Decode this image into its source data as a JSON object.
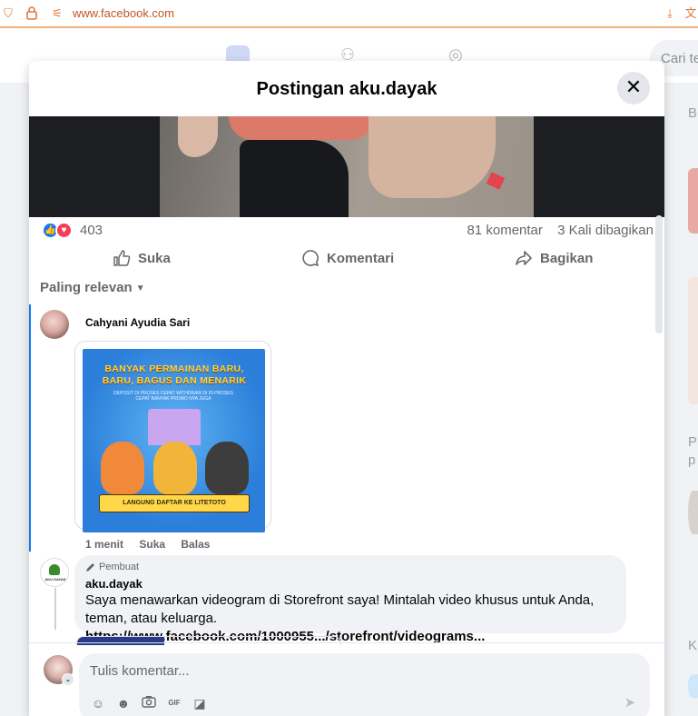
{
  "browser": {
    "url": "www.facebook.com",
    "icons": [
      "shield-icon",
      "lock-icon",
      "site-settings-icon",
      "download-icon",
      "translate-icon"
    ]
  },
  "fb_header": {
    "search_placeholder": "Cari te"
  },
  "right_rail": {
    "text_1": "B",
    "text_2": "P",
    "text_3": "p",
    "text_4": "K"
  },
  "modal": {
    "title": "Postingan aku.dayak",
    "close_icon": "close-icon",
    "post": {
      "reaction_count": "403",
      "reaction_types": [
        "like",
        "love"
      ],
      "comments_count": "81 komentar",
      "shares_count": "3 Kali dibagikan",
      "actions": {
        "like": "Suka",
        "comment": "Komentari",
        "share": "Bagikan"
      }
    },
    "sort": {
      "label": "Paling relevan"
    },
    "comments": [
      {
        "author": "Cahyani Ayudia Sari",
        "image": {
          "headline": "BANYAK PERMAINAN BARU, BARU, BAGUS DAN MENARIK",
          "subtext": "DEPOSIT DI PROSES CEPAT WITHDRAW DI DI PROSES CEPAT BANYAK PROMO NYA JUGA",
          "ribbon": "LANGUNG DAFTAR KE LITETOTO"
        },
        "time": "1 menit",
        "like": "Suka",
        "reply": "Balas"
      },
      {
        "badge": "Pembuat",
        "author": "aku.dayak",
        "avatar_text": "AKU DAYAK",
        "text": "Saya menawarkan videogram di Storefront saya! Mintalah video khusus untuk Anda, teman, atau keluarga.",
        "link": "https://www.facebook.com/1000955.../storefront/videograms..."
      }
    ],
    "composer": {
      "placeholder": "Tulis komentar...",
      "tools": [
        "avatar-sticker-icon",
        "emoji-icon",
        "camera-icon",
        "gif-icon",
        "sticker-icon"
      ],
      "send_icon": "send-icon"
    }
  },
  "colors": {
    "accent": "#1877f2",
    "love": "#f33e58",
    "browser_accent": "#e07a3a"
  }
}
